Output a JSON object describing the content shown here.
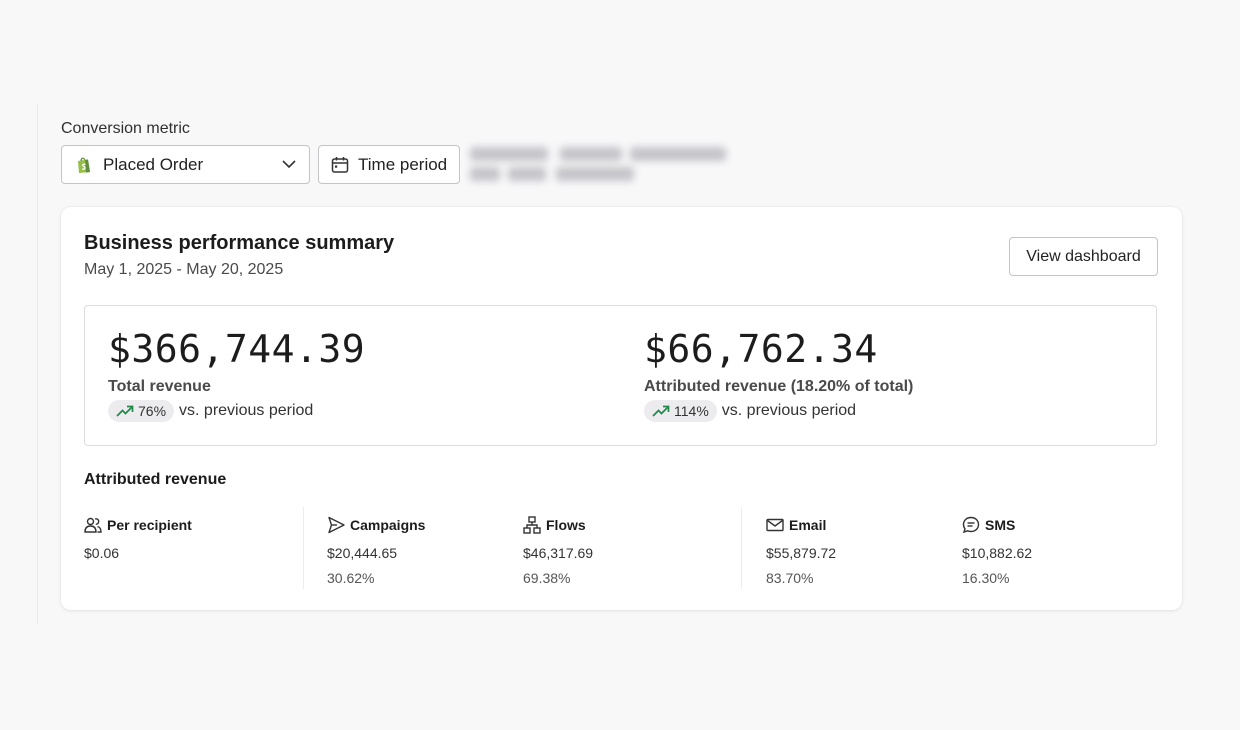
{
  "filters": {
    "metric_label": "Conversion metric",
    "metric_value": "Placed Order",
    "time_period_label": "Time period"
  },
  "summary": {
    "title": "Business performance summary",
    "date_range": "May 1, 2025 - May 20, 2025",
    "view_dashboard": "View dashboard",
    "total": {
      "value": "$366,744.39",
      "label": "Total revenue",
      "change": "76%",
      "comparison": "vs. previous period"
    },
    "attributed": {
      "value": "$66,762.34",
      "label": "Attributed revenue (18.20% of total)",
      "change": "114%",
      "comparison": "vs. previous period"
    }
  },
  "attributed_breakdown": {
    "title": "Attributed revenue",
    "columns": [
      {
        "label": "Per recipient",
        "icon": "people-icon",
        "value": "$0.06",
        "percent": ""
      },
      {
        "label": "Campaigns",
        "icon": "send-icon",
        "value": "$20,444.65",
        "percent": "30.62%"
      },
      {
        "label": "Flows",
        "icon": "flow-icon",
        "value": "$46,317.69",
        "percent": "69.38%"
      },
      {
        "label": "Email",
        "icon": "mail-icon",
        "value": "$55,879.72",
        "percent": "83.70%"
      },
      {
        "label": "SMS",
        "icon": "sms-icon",
        "value": "$10,882.62",
        "percent": "16.30%"
      }
    ]
  },
  "colors": {
    "trend_up": "#1f8a4c",
    "shopify_green": "#5e8e3e"
  }
}
